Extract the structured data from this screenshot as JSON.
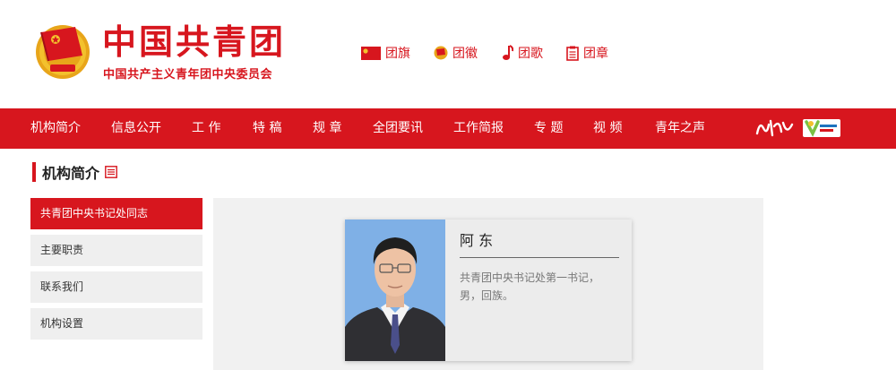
{
  "header": {
    "title": "中国共青团",
    "subtitle": "中国共产主义青年团中央委员会",
    "quicklinks": [
      {
        "label": "团旗",
        "icon": "flag-icon"
      },
      {
        "label": "团徽",
        "icon": "emblem-icon"
      },
      {
        "label": "团歌",
        "icon": "music-note-icon"
      },
      {
        "label": "团章",
        "icon": "document-icon"
      }
    ]
  },
  "nav": {
    "items": [
      "机构简介",
      "信息公开",
      "工 作",
      "特 稿",
      "规 章",
      "全团要讯",
      "工作简报",
      "专 题",
      "视 频",
      "青年之声"
    ]
  },
  "section": {
    "title": "机构简介"
  },
  "sidebar": {
    "items": [
      "共青团中央书记处同志",
      "主要职责",
      "联系我们",
      "机构设置"
    ],
    "active_index": 0
  },
  "profile": {
    "name": "阿 东",
    "description": "共青团中央书记处第一书记，男，回族。"
  },
  "colors": {
    "brand_red": "#d7161e",
    "sidebar_bg": "#efefef",
    "content_bg": "#f1f1f1"
  }
}
